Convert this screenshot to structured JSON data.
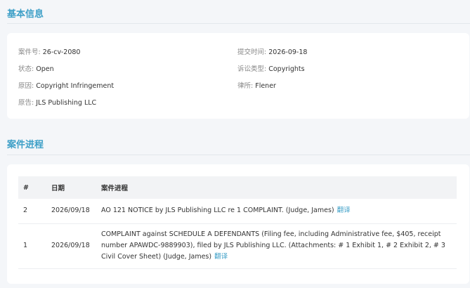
{
  "basic_info": {
    "title": "基本信息",
    "fields": {
      "case_no": {
        "label": "案件号: ",
        "value": "26-cv-2080"
      },
      "submit_time": {
        "label": "提交时间: ",
        "value": "2026-09-18"
      },
      "status": {
        "label": "状态: ",
        "value": "Open"
      },
      "case_type": {
        "label": "诉讼类型: ",
        "value": "Copyrights"
      },
      "cause": {
        "label": "原因: ",
        "value": "Copyright Infringement"
      },
      "law_firm": {
        "label": "律所: ",
        "value": "Flener"
      },
      "plaintiff": {
        "label": "原告: ",
        "value": "JLS Publishing LLC"
      }
    }
  },
  "progress": {
    "title": "案件进程",
    "columns": {
      "index": "#",
      "date": "日期",
      "progress": "案件进程"
    },
    "rows": [
      {
        "index": "2",
        "date": "2026/09/18",
        "text": "AO 121 NOTICE by JLS Publishing LLC re 1 COMPLAINT. (Judge, James)",
        "translate": "翻译"
      },
      {
        "index": "1",
        "date": "2026/09/18",
        "text": "COMPLAINT against SCHEDULE A DEFENDANTS (Filing fee, including Administrative fee, $405, receipt number APAWDC-9889903), filed by JLS Publishing LLC. (Attachments: # 1 Exhibit 1, # 2 Exhibit 2, # 3 Civil Cover Sheet) (Judge, James)",
        "translate": "翻译"
      }
    ]
  },
  "colors": {
    "accent": "#3d9fc7",
    "page_bg": "#f4f6f9",
    "card_bg": "#ffffff",
    "header_bg": "#f2f3f5"
  }
}
